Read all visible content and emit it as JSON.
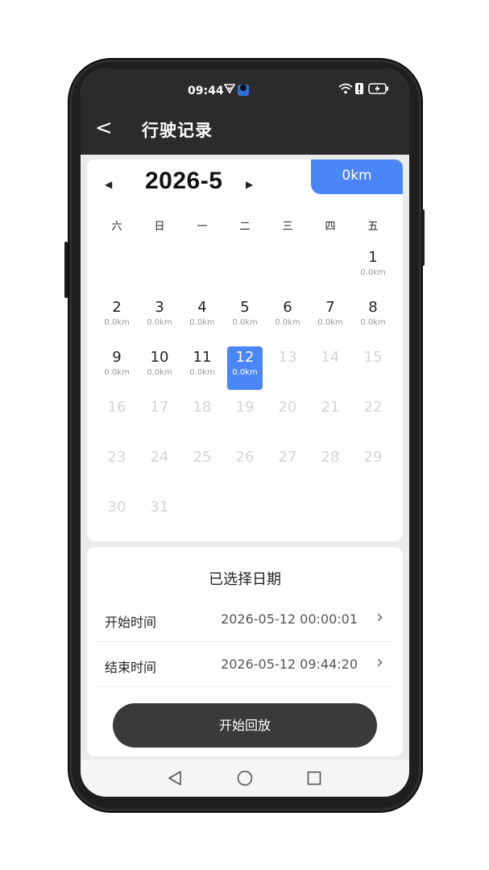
{
  "status": {
    "time": "09:44"
  },
  "header": {
    "back_glyph": "<",
    "title": "行驶记录"
  },
  "calendar": {
    "prev_glyph": "◀",
    "next_glyph": "▶",
    "month": "2026-5",
    "total_km": "0km",
    "weekdays": [
      "六",
      "日",
      "一",
      "二",
      "三",
      "四",
      "五"
    ],
    "weeks": [
      [
        null,
        null,
        null,
        null,
        null,
        null,
        {
          "day": "1",
          "km": "0.0km"
        }
      ],
      [
        {
          "day": "2",
          "km": "0.0km"
        },
        {
          "day": "3",
          "km": "0.0km"
        },
        {
          "day": "4",
          "km": "0.0km"
        },
        {
          "day": "5",
          "km": "0.0km"
        },
        {
          "day": "6",
          "km": "0.0km"
        },
        {
          "day": "7",
          "km": "0.0km"
        },
        {
          "day": "8",
          "km": "0.0km"
        }
      ],
      [
        {
          "day": "9",
          "km": "0.0km"
        },
        {
          "day": "10",
          "km": "0.0km"
        },
        {
          "day": "11",
          "km": "0.0km"
        },
        {
          "day": "12",
          "km": "0.0km",
          "selected": true
        },
        {
          "day": "13",
          "disabled": true
        },
        {
          "day": "14",
          "disabled": true
        },
        {
          "day": "15",
          "disabled": true
        }
      ],
      [
        {
          "day": "16",
          "disabled": true
        },
        {
          "day": "17",
          "disabled": true
        },
        {
          "day": "18",
          "disabled": true
        },
        {
          "day": "19",
          "disabled": true
        },
        {
          "day": "20",
          "disabled": true
        },
        {
          "day": "21",
          "disabled": true
        },
        {
          "day": "22",
          "disabled": true
        }
      ],
      [
        {
          "day": "23",
          "disabled": true
        },
        {
          "day": "24",
          "disabled": true
        },
        {
          "day": "25",
          "disabled": true
        },
        {
          "day": "26",
          "disabled": true
        },
        {
          "day": "27",
          "disabled": true
        },
        {
          "day": "28",
          "disabled": true
        },
        {
          "day": "29",
          "disabled": true
        }
      ],
      [
        {
          "day": "30",
          "disabled": true
        },
        {
          "day": "31",
          "disabled": true
        },
        null,
        null,
        null,
        null,
        null
      ]
    ]
  },
  "selection": {
    "title": "已选择日期",
    "start_label": "开始时间",
    "start_value": "2026-05-12 00:00:01",
    "end_label": "结束时间",
    "end_value": "2026-05-12 09:44:20",
    "chevron": "›",
    "play_label": "开始回放"
  },
  "colors": {
    "accent": "#4a86f6",
    "dark": "#2b2b2b",
    "button": "#3a3a3a"
  },
  "icons": [
    "back-arrow-icon",
    "wifi-icon",
    "battery-icon",
    "nav-back-icon",
    "nav-home-icon",
    "nav-recents-icon"
  ]
}
